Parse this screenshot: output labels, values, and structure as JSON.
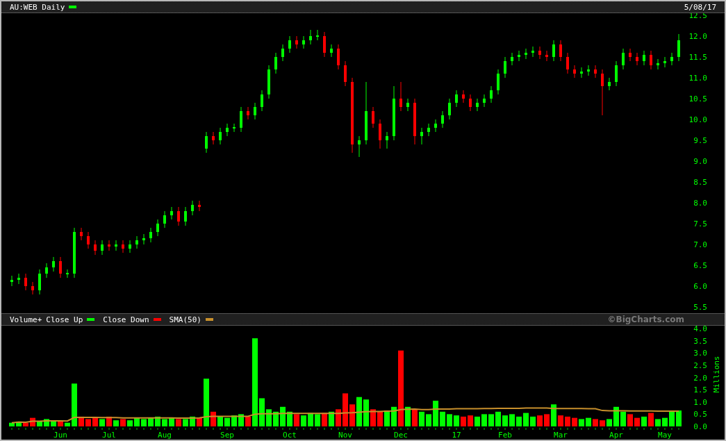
{
  "header": {
    "title": "AU:WEB Daily",
    "swatch": {
      "color": "#00ff00"
    },
    "date": "5/08/17"
  },
  "price_chart": {
    "chart_data": {
      "type": "candlestick",
      "ylim": [
        5.5,
        12.5
      ],
      "categories": [
        null,
        null,
        null,
        null,
        null,
        null,
        null,
        null,
        null,
        null,
        null,
        null,
        null,
        null,
        null,
        null,
        null,
        null,
        null,
        null,
        null,
        null,
        null,
        null,
        null,
        null,
        null,
        null,
        null,
        null,
        null,
        null,
        null,
        null,
        null,
        null,
        null,
        null,
        null,
        null,
        null,
        null,
        null,
        null,
        null,
        null,
        null,
        null,
        null,
        null,
        null,
        null,
        null,
        null,
        null,
        null,
        null,
        null,
        null,
        null,
        null,
        null,
        null,
        null,
        null,
        null,
        null,
        null,
        null,
        null,
        null,
        null,
        null,
        null,
        null,
        null,
        null,
        null,
        null,
        null,
        null,
        null,
        null,
        null,
        null,
        null,
        null,
        null,
        null,
        null,
        null,
        null,
        null,
        null,
        null,
        null,
        null
      ],
      "yticks": [
        {
          "value": 12.5,
          "label": "12.5"
        },
        {
          "value": 12,
          "label": "12.0"
        },
        {
          "value": 11.5,
          "label": "11.5"
        },
        {
          "value": 11,
          "label": "11.0"
        },
        {
          "value": 10.5,
          "label": "10.5"
        },
        {
          "value": 10,
          "label": "10.0"
        },
        {
          "value": 9.5,
          "label": "9.5"
        },
        {
          "value": 9,
          "label": "9.0"
        },
        {
          "value": 8.5,
          "label": "8.5"
        },
        {
          "value": 8,
          "label": "8.0"
        },
        {
          "value": 7.5,
          "label": "7.5"
        },
        {
          "value": 7,
          "label": "7.0"
        },
        {
          "value": 6.5,
          "label": "6.5"
        },
        {
          "value": 6,
          "label": "6.0"
        },
        {
          "value": 5.5,
          "label": "5.5"
        }
      ],
      "ohlc": [
        [
          6.1,
          6.25,
          6.0,
          6.15
        ],
        [
          6.15,
          6.3,
          6.05,
          6.2
        ],
        [
          6.2,
          6.3,
          5.9,
          6.0
        ],
        [
          6.0,
          6.1,
          5.8,
          5.9
        ],
        [
          5.9,
          6.4,
          5.8,
          6.3
        ],
        [
          6.3,
          6.55,
          6.2,
          6.45
        ],
        [
          6.45,
          6.7,
          6.35,
          6.6
        ],
        [
          6.6,
          6.7,
          6.2,
          6.3
        ],
        [
          6.3,
          6.4,
          6.2,
          6.3
        ],
        [
          6.3,
          7.4,
          6.2,
          7.3
        ],
        [
          7.3,
          7.4,
          7.1,
          7.2
        ],
        [
          7.2,
          7.3,
          6.9,
          7.0
        ],
        [
          7.0,
          7.1,
          6.75,
          6.85
        ],
        [
          6.85,
          7.1,
          6.75,
          7.0
        ],
        [
          7.0,
          7.1,
          6.85,
          6.95
        ],
        [
          6.95,
          7.1,
          6.85,
          7.0
        ],
        [
          7.0,
          7.1,
          6.8,
          6.9
        ],
        [
          6.9,
          7.1,
          6.8,
          7.0
        ],
        [
          7.0,
          7.2,
          6.9,
          7.1
        ],
        [
          7.1,
          7.25,
          7.0,
          7.15
        ],
        [
          7.15,
          7.4,
          7.05,
          7.3
        ],
        [
          7.3,
          7.6,
          7.2,
          7.5
        ],
        [
          7.5,
          7.8,
          7.4,
          7.7
        ],
        [
          7.7,
          7.9,
          7.6,
          7.8
        ],
        [
          7.8,
          7.9,
          7.45,
          7.55
        ],
        [
          7.55,
          7.9,
          7.45,
          7.8
        ],
        [
          7.8,
          8.05,
          7.7,
          7.95
        ],
        [
          7.95,
          8.05,
          7.8,
          7.9
        ],
        [
          9.3,
          9.7,
          9.2,
          9.6
        ],
        [
          9.6,
          9.7,
          9.4,
          9.5
        ],
        [
          9.5,
          9.8,
          9.4,
          9.7
        ],
        [
          9.7,
          9.9,
          9.6,
          9.8
        ],
        [
          9.8,
          9.9,
          9.7,
          9.8
        ],
        [
          9.8,
          10.3,
          9.7,
          10.2
        ],
        [
          10.2,
          10.3,
          10.0,
          10.1
        ],
        [
          10.1,
          10.4,
          10.0,
          10.3
        ],
        [
          10.3,
          10.7,
          10.2,
          10.6
        ],
        [
          10.6,
          11.3,
          10.5,
          11.2
        ],
        [
          11.2,
          11.6,
          11.1,
          11.5
        ],
        [
          11.5,
          11.8,
          11.4,
          11.7
        ],
        [
          11.7,
          12.0,
          11.6,
          11.9
        ],
        [
          11.9,
          12.0,
          11.7,
          11.8
        ],
        [
          11.8,
          12.0,
          11.7,
          11.9
        ],
        [
          11.9,
          12.15,
          11.8,
          12.0
        ],
        [
          12.0,
          12.15,
          11.9,
          12.0
        ],
        [
          12.0,
          12.1,
          11.5,
          11.6
        ],
        [
          11.6,
          11.8,
          11.5,
          11.7
        ],
        [
          11.7,
          11.8,
          11.2,
          11.3
        ],
        [
          11.3,
          11.4,
          10.8,
          10.9
        ],
        [
          10.9,
          11.0,
          9.2,
          9.4
        ],
        [
          9.4,
          9.6,
          9.1,
          9.5
        ],
        [
          9.5,
          10.9,
          9.4,
          10.2
        ],
        [
          10.2,
          10.3,
          9.8,
          9.9
        ],
        [
          9.9,
          10.0,
          9.3,
          9.5
        ],
        [
          9.5,
          9.7,
          9.3,
          9.6
        ],
        [
          9.6,
          10.8,
          9.5,
          10.5
        ],
        [
          10.5,
          10.9,
          10.2,
          10.3
        ],
        [
          10.3,
          10.5,
          10.2,
          10.4
        ],
        [
          10.4,
          10.5,
          9.4,
          9.6
        ],
        [
          9.6,
          9.8,
          9.4,
          9.7
        ],
        [
          9.7,
          9.9,
          9.6,
          9.8
        ],
        [
          9.8,
          10.0,
          9.7,
          9.9
        ],
        [
          9.9,
          10.2,
          9.8,
          10.1
        ],
        [
          10.1,
          10.5,
          10.0,
          10.4
        ],
        [
          10.4,
          10.7,
          10.3,
          10.6
        ],
        [
          10.6,
          10.7,
          10.4,
          10.5
        ],
        [
          10.5,
          10.6,
          10.2,
          10.3
        ],
        [
          10.3,
          10.5,
          10.2,
          10.4
        ],
        [
          10.4,
          10.6,
          10.3,
          10.5
        ],
        [
          10.5,
          10.8,
          10.4,
          10.7
        ],
        [
          10.7,
          11.2,
          10.6,
          11.1
        ],
        [
          11.1,
          11.5,
          11.0,
          11.4
        ],
        [
          11.4,
          11.6,
          11.3,
          11.5
        ],
        [
          11.5,
          11.65,
          11.4,
          11.55
        ],
        [
          11.55,
          11.7,
          11.45,
          11.6
        ],
        [
          11.6,
          11.75,
          11.5,
          11.65
        ],
        [
          11.65,
          11.75,
          11.45,
          11.55
        ],
        [
          11.55,
          11.65,
          11.4,
          11.5
        ],
        [
          11.5,
          11.9,
          11.4,
          11.8
        ],
        [
          11.8,
          11.9,
          11.4,
          11.5
        ],
        [
          11.5,
          11.6,
          11.1,
          11.2
        ],
        [
          11.2,
          11.3,
          11.0,
          11.1
        ],
        [
          11.1,
          11.25,
          11.0,
          11.15
        ],
        [
          11.15,
          11.3,
          11.05,
          11.2
        ],
        [
          11.2,
          11.3,
          11.0,
          11.1
        ],
        [
          11.1,
          11.2,
          10.1,
          10.8
        ],
        [
          10.8,
          11.0,
          10.7,
          10.9
        ],
        [
          10.9,
          11.4,
          10.8,
          11.3
        ],
        [
          11.3,
          11.7,
          11.2,
          11.6
        ],
        [
          11.6,
          11.7,
          11.4,
          11.5
        ],
        [
          11.5,
          11.6,
          11.3,
          11.4
        ],
        [
          11.4,
          11.65,
          11.3,
          11.55
        ],
        [
          11.55,
          11.65,
          11.2,
          11.3
        ],
        [
          11.3,
          11.45,
          11.2,
          11.35
        ],
        [
          11.35,
          11.5,
          11.25,
          11.4
        ],
        [
          11.4,
          11.6,
          11.3,
          11.5
        ],
        [
          11.5,
          12.05,
          11.4,
          11.9
        ]
      ]
    }
  },
  "volume_legend": {
    "items": [
      {
        "kind": "up",
        "label": "Close Up",
        "color": "#00ff00"
      },
      {
        "kind": "down",
        "label": "Close Down",
        "color": "#ff0000"
      }
    ],
    "credit": "©BigCharts.com"
  },
  "volume_chart": {
    "chart_data": {
      "type": "bar",
      "ylabel": "Millions",
      "ylim": [
        0,
        4
      ],
      "categories": [
        null,
        null,
        null,
        null,
        null,
        null,
        null,
        "Jun",
        null,
        null,
        null,
        null,
        null,
        null,
        "Jul",
        null,
        null,
        null,
        null,
        null,
        null,
        null,
        "Aug",
        null,
        null,
        null,
        null,
        null,
        null,
        null,
        null,
        "Sep",
        null,
        null,
        null,
        null,
        null,
        null,
        null,
        null,
        "Oct",
        null,
        null,
        null,
        null,
        null,
        null,
        null,
        "Nov",
        null,
        null,
        null,
        null,
        null,
        null,
        null,
        "Dec",
        null,
        null,
        null,
        null,
        null,
        null,
        null,
        "17",
        null,
        null,
        null,
        null,
        null,
        null,
        "Feb",
        null,
        null,
        null,
        null,
        null,
        null,
        null,
        "Mar",
        null,
        null,
        null,
        null,
        null,
        null,
        null,
        "Apr",
        null,
        null,
        null,
        null,
        null,
        null,
        "May",
        null,
        null
      ],
      "yticks": [
        {
          "value": 4,
          "label": "4.0"
        },
        {
          "value": 3.5,
          "label": "3.5"
        },
        {
          "value": 3,
          "label": "3.0"
        },
        {
          "value": 2.5,
          "label": "2.5"
        },
        {
          "value": 2,
          "label": "2.0"
        },
        {
          "value": 1.5,
          "label": "1.5"
        },
        {
          "value": 1,
          "label": "1.0"
        },
        {
          "value": 0.5,
          "label": "0.5"
        },
        {
          "value": 0,
          "label": "0.0"
        }
      ],
      "series": [
        {
          "name": "Volume+",
          "colors": [
            "#00ff00",
            "#00ff00",
            "#ff0000",
            "#ff0000",
            "#00ff00",
            "#00ff00",
            "#00ff00",
            "#ff0000",
            "#00ff00",
            "#00ff00",
            "#ff0000",
            "#ff0000",
            "#ff0000",
            "#00ff00",
            "#ff0000",
            "#00ff00",
            "#ff0000",
            "#00ff00",
            "#00ff00",
            "#00ff00",
            "#00ff00",
            "#00ff00",
            "#00ff00",
            "#00ff00",
            "#ff0000",
            "#00ff00",
            "#00ff00",
            "#ff0000",
            "#00ff00",
            "#ff0000",
            "#00ff00",
            "#00ff00",
            "#00ff00",
            "#00ff00",
            "#ff0000",
            "#00ff00",
            "#00ff00",
            "#00ff00",
            "#00ff00",
            "#00ff00",
            "#00ff00",
            "#ff0000",
            "#00ff00",
            "#00ff00",
            "#00ff00",
            "#ff0000",
            "#00ff00",
            "#ff0000",
            "#ff0000",
            "#ff0000",
            "#00ff00",
            "#00ff00",
            "#ff0000",
            "#ff0000",
            "#00ff00",
            "#00ff00",
            "#ff0000",
            "#00ff00",
            "#ff0000",
            "#00ff00",
            "#00ff00",
            "#00ff00",
            "#00ff00",
            "#00ff00",
            "#00ff00",
            "#ff0000",
            "#ff0000",
            "#00ff00",
            "#00ff00",
            "#00ff00",
            "#00ff00",
            "#00ff00",
            "#00ff00",
            "#00ff00",
            "#00ff00",
            "#00ff00",
            "#ff0000",
            "#ff0000",
            "#00ff00",
            "#ff0000",
            "#ff0000",
            "#ff0000",
            "#00ff00",
            "#00ff00",
            "#ff0000",
            "#ff0000",
            "#00ff00",
            "#00ff00",
            "#00ff00",
            "#ff0000",
            "#ff0000",
            "#00ff00",
            "#ff0000",
            "#00ff00",
            "#00ff00",
            "#00ff00",
            "#00ff00"
          ],
          "values": [
            0.15,
            0.2,
            0.15,
            0.35,
            0.2,
            0.3,
            0.25,
            0.2,
            0.15,
            1.75,
            0.4,
            0.3,
            0.35,
            0.3,
            0.4,
            0.25,
            0.3,
            0.25,
            0.35,
            0.3,
            0.35,
            0.4,
            0.3,
            0.35,
            0.3,
            0.3,
            0.4,
            0.35,
            1.95,
            0.6,
            0.4,
            0.35,
            0.45,
            0.5,
            0.4,
            3.6,
            1.15,
            0.7,
            0.6,
            0.8,
            0.6,
            0.5,
            0.45,
            0.55,
            0.5,
            0.55,
            0.6,
            0.7,
            1.35,
            0.9,
            1.2,
            1.1,
            0.7,
            0.6,
            0.65,
            0.8,
            3.1,
            0.8,
            0.7,
            0.6,
            0.5,
            1.05,
            0.6,
            0.5,
            0.45,
            0.4,
            0.45,
            0.4,
            0.5,
            0.5,
            0.6,
            0.45,
            0.5,
            0.4,
            0.55,
            0.4,
            0.45,
            0.5,
            0.9,
            0.45,
            0.4,
            0.35,
            0.3,
            0.35,
            0.3,
            0.25,
            0.3,
            0.8,
            0.6,
            0.5,
            0.35,
            0.4,
            0.55,
            0.3,
            0.35,
            0.6,
            0.65
          ]
        },
        {
          "name": "SMA(50)",
          "type": "line",
          "color": "#c8902c",
          "values": [
            0.15,
            0.18,
            0.17,
            0.21,
            0.21,
            0.23,
            0.23,
            0.23,
            0.22,
            0.37,
            0.37,
            0.37,
            0.37,
            0.36,
            0.36,
            0.36,
            0.35,
            0.35,
            0.35,
            0.35,
            0.35,
            0.35,
            0.35,
            0.35,
            0.34,
            0.34,
            0.34,
            0.35,
            0.4,
            0.41,
            0.41,
            0.41,
            0.41,
            0.41,
            0.41,
            0.5,
            0.52,
            0.52,
            0.52,
            0.53,
            0.53,
            0.53,
            0.53,
            0.53,
            0.53,
            0.53,
            0.53,
            0.53,
            0.55,
            0.56,
            0.58,
            0.6,
            0.61,
            0.61,
            0.62,
            0.63,
            0.69,
            0.7,
            0.71,
            0.69,
            0.69,
            0.71,
            0.71,
            0.71,
            0.72,
            0.72,
            0.72,
            0.72,
            0.73,
            0.73,
            0.74,
            0.74,
            0.74,
            0.74,
            0.75,
            0.75,
            0.75,
            0.75,
            0.73,
            0.73,
            0.73,
            0.73,
            0.73,
            0.72,
            0.72,
            0.65,
            0.64,
            0.64,
            0.64,
            0.63,
            0.63,
            0.63,
            0.63,
            0.62,
            0.62,
            0.62,
            0.62
          ]
        }
      ]
    }
  }
}
